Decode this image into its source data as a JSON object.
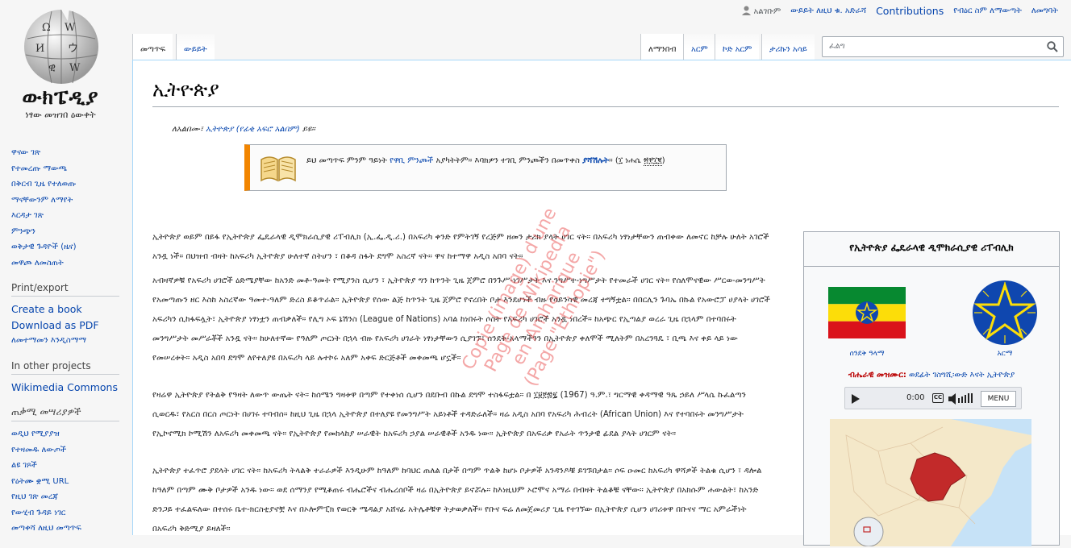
{
  "logo": {
    "wordmark": "ውክፔዲያ",
    "tagline": "ነፃው መዝገበ ዕውቀት"
  },
  "personal_tools": {
    "user": "አልገቡም",
    "talk": "ውይይት ለዚህ ቁ. አድራሻ",
    "contributions": "Contributions",
    "create_account": "የብዕር ስም ለማውጣት",
    "login": "ለመግባት"
  },
  "tabs": {
    "article": "መጣጥፍ",
    "talk": "ውይይት",
    "read": "ለማንበብ",
    "edit": "አርም",
    "edit_source": "ኮድ አርም",
    "history": "ታሪኩን አሳይ"
  },
  "search": {
    "placeholder": "ፈልግ"
  },
  "sidebar": {
    "nav": [
      "ዋናው ገጽ",
      "የተመረጡ ማውጫ",
      "በቅርብ ጊዜ የተለወጡ",
      "ማናቸውንም ለማየት",
      "እርዳታ ገጽ",
      "ምንጭን",
      "ወቅታዊ ጉዳዮች (ዜና)",
      "መዋጮ ለመስጠት"
    ],
    "print_heading": "Print/export",
    "print": [
      "Create a book",
      "Download as PDF",
      "ለመተማመን እንዲስማማ"
    ],
    "projects_heading": "In other projects",
    "projects": [
      "Wikimedia Commons"
    ],
    "tools_heading": "ጠቃሚ መሣሪያዎች",
    "tools": [
      "ወዲህ የሚያያዝ",
      "የተዛመዱ ለውጦች",
      "ልዩ ገጾች",
      "የዕትሙ ቋሚ URL",
      "የዚህ ገጽ መረጃ",
      "የውሂብ ጉዳይ ነገር",
      "መጣቀሻ ለዚህ መጣጥፍ"
    ]
  },
  "article": {
    "title": "ኢትዮጵያ",
    "hatnote_prefix": "ለአልበሙ፣",
    "hatnote_link": "ኢትዮጵያ (የፊቂ አፍሮ አልበም)",
    "hatnote_suffix": "ይዩ።",
    "ambox_text": "ይህ መጣጥፍ ምንም ዓይነት",
    "ambox_link": "የዋቢ ምንጮች",
    "ambox_text2": "አያካትትም። እባክዎን ተገቢ ምንጮችን በመጥቀስ",
    "ambox_link2": "ያሻሽሉት",
    "ambox_text3": "። (፲ ነሐሴ",
    "ambox_date": "፳፻፲፪",
    "ambox_text4": ")"
  },
  "paragraphs": [
    "ኢትዮጵያ ወይም በይፋ የኢትዮጵያ ፌዴራላዊ ዲሞክራሲያዊ ሪፐብሊክ (ኢ.ፌ.ዲ.ሪ.) በአፍሪካ ቀንድ የምትገኝ የረጅም ዘመን ታሪክ ያላት ሀገር ናት። በአፍሪካ ነፃነታቸውን ጠብቀው ለመኖር ከቻሉ ሁለት አገሮች አንዷ ነች። በህዝብ ብዛት ከአፍሪካ ኢትዮጵያ ሁለተኛ ስትሆን ፣ በቆዳ ስፋት ደግሞ አስረኛ ናት። ዋና ከተማዋ አዲስ አበባ ናት።",
    "አብዛኛዎቹ የአፍሪካ ሀገሮች ዕድሜያቸው ከአንድ መቶ-ዓመት የሚያንስ ሲሆን ፣ ኢትዮጵያ ግን ከጥንት ጊዜ ጀምሮ በንጉሥ-ነገሥታት እና ንግሥተ-ነግሥታት የተመራች ሀገር ናት። የሰለሞናዊው ሥርወ-መንግሥት የአመጣጡን ዘር እስከ አስረኛው ዓመተ-ዓለም ድረስ ይቆጥራል። ኢትዮጵያ የሰው ልጅ ከጥንት ጊዜ ጀምሮ የኖረበት ቦታ እንደሆነች ብዙ የሳይንሳዊ መረጃ ተግኝቷል። በበርሊን ጉባኤ በኩል የአውሮፓ ሀያላት ሀገሮች አፍሪካን ሲከፋፍሏት፣ ኢትዮጵያ ነፃነቷን ጠብቃለች። የሊግ ኦፍ ኔሽንስ (League of Nations) አባል ከነበሩት ሶስት የአፍሪካ ሀገሮች አንዷ ነበረች። ከአጭር የኢጣልያ ወረራ ጊዜ በኋላም በተባበሩት መንግሥታት መሥራቾች አንዷ ናት። ከሁለተኛው የዓለም ጦርነት በኋላ ብዙ የአፍሪካ ሀገራት ነፃነታቸውን ሲያገኙ፣ ሰንደቅ-አላማችንን በኢትዮጵያ ቀለሞች ሚለትም በአረንጓዴ ፣ ቢጫ እና ቀይ ላይ ነው የመሠረቱት። አዲስ አበባ ደግሞ ለየተለያዩ በአፍሪካ ላይ ሉተኮሩ አለም አቀፍ ድርጅቶች መቀመጫ ሆኗች።",
    "የዛሬዋ ኢትዮጵያ የትልቅ የዓዛት ለውጥ ውጤት ናት። ከሰሜን ግዛቱዋ በጣም የተቀነሰ ሲሆን በደቡብ በኩል ደግሞ ተስፋፍቷል። በ ፲፱፻፷፯ (1967) ዓ.ም.፣ ግርማዊ ቀዳማዊ ዓጼ ኃይለ ሥላሴ ኩፈልጣን ሲወርዱ፣ የአርስ በርስ ጦርነት በሀገሩ ተባብሰ። ከዚህ ጊዜ በኋላ ኢትዮጵያ በተለያዩ የመንግሥት አይነቶች ተዳድራለች። ዛሬ አዲስ አበባ የአፍሪካ ሕብረት (African Union) እና የተባበሩት መንግሥታት የኢኮኖሚክ ኮሚሽን ለአፍሪካ መቀመጫ ናት። የኢትዮጵያ የመከላከያ ሠራዊት ከአፍሪካ ኃያል ሠራዊቶች አንዱ ነው። ኢትዮጵያ በአፍሪቃ የአራት ጥንታዊ ፊደል ያላት ሀገርም ናት።",
    "ኢትዮጵያ ተፈጥሮ ያደላት ሀገር ናት። ከአፍሪካ ትላልቅ ተራራዎች እንዲሁም ከዓለም ከባህር ጠለል በታች በጣም ጥልቅ ከሆኑ ቦታዎች አንዳንዶቹ ይገኙበታል። ሶፍ ዑመር ከአፍሪካ ዋሻዎች ትልቁ ሲሆን ፣ ዳሎል ከዓለም በጣም ሙቅ ቦታዎች አንዱ ነው። ወደ ሰማንያ የሚቆጠሩ ብሔሮችና ብሔረሰቦች ዛሬ በኢትዮጵያ ይኖሯሉ። ከእነዚህም ኦሮሞና አማራ በብዛት ትልቆቹ ናቸው። ኢትዮጵያ በአክሱም ሐውልት፣ ከአንድ ድንጋይ ተፈልፍለው በተሰሩ ቤተ-ክርስቲያኖቿ እና በኦሎምፒክ የወርቅ ሜዳልያ አሸናፊ አትሌቶቹዋ ትታወቃለች። የቡና ፍሬ ለመጀመሪያ ጊዜ የተገኘው በኢትዮጵያ ሲሆን ሀገሪቱዋ በቡናና ማር አምራችነት በአፍሪካ ቅድሚያ ይዛለች።"
  ],
  "infobox": {
    "title": "የኢትዮጵያ ፌዴራላዊ ዲሞክራሲያዊ ሪፐብሊክ",
    "flag_caption": "ሰንደቅ ዓላማ",
    "emblem_caption": "አርማ",
    "anthem_label": "ብሔራዊ መዝሙር:",
    "anthem_title": "ወደፊት ገስግሺ፡ውድ እናት ኢትዮጵያ",
    "player_time": "0:00",
    "player_cc": "CC",
    "player_menu": "MENU"
  },
  "watermark": [
    "Copie (image) d'une",
    "Page de Wikipedia",
    "en Amharique",
    "(Page \"Ethiopie\")"
  ],
  "colors": {
    "link": "#0645ad",
    "redlink": "#ba0000",
    "ambox_border": "#f28500",
    "flag_green": "#078930",
    "flag_yellow": "#fcdd09",
    "flag_red": "#da121a",
    "emblem_blue": "#0f47af"
  }
}
